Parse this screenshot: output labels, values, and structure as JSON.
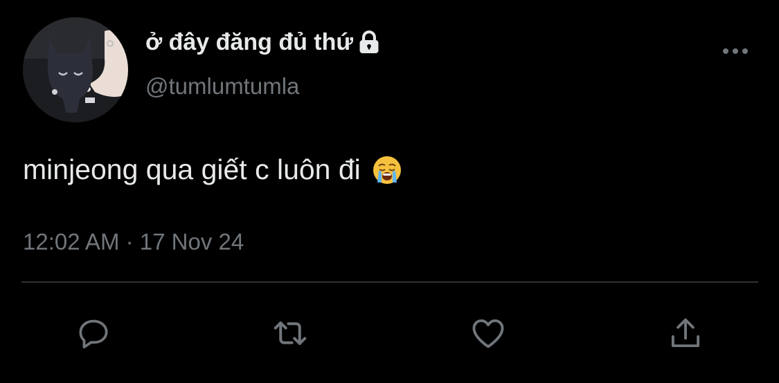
{
  "tweet": {
    "display_name": "ở đây đăng đủ thứ",
    "handle": "@tumlumtumla",
    "text": "minjeong qua giết c luôn đi",
    "emoji": "loudly-crying-face",
    "timestamp": "12:02 AM · 17 Nov 24"
  },
  "icons": {
    "lock": "lock-icon",
    "more": "more-icon",
    "reply": "reply-icon",
    "retweet": "retweet-icon",
    "like": "heart-icon",
    "share": "share-icon"
  },
  "colors": {
    "background": "#000000",
    "primary_text": "#e7e9ea",
    "secondary_text": "#71767b",
    "divider": "#2f3336"
  }
}
